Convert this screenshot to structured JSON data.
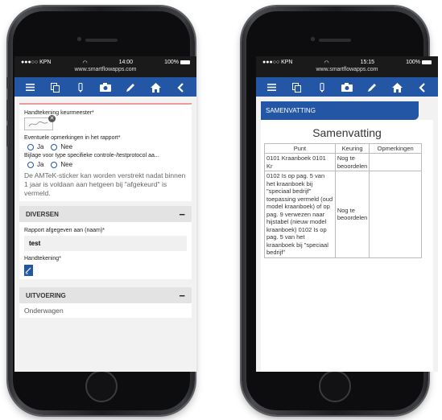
{
  "left": {
    "status": {
      "carrier": "●●●○○ KPN",
      "time": "14:00",
      "battery": "100%",
      "url": "www.smartflowapps.com"
    },
    "signature_label": "Handtekening keurmeester*",
    "remarks_label": "Eventuele opmerkingen in het rapport*",
    "radio_yes": "Ja",
    "radio_no": "Nee",
    "attachment_label": "Bijlage voor type specifieke controle-/testprotocol aa...",
    "notice": "De AMTeK-sticker kan worden verstrekt nadat binnen 1 jaar is voldaan aan hetgeen bij \"afgekeurd\" is vermeld.",
    "section_diversen": "DIVERSEN",
    "report_label": "Rapport afgegeven aan (naam)*",
    "report_value": "test",
    "signature2_label": "Handtekening*",
    "section_uitvoering": "UITVOERING",
    "onderwagen": "Onderwagen"
  },
  "right": {
    "status": {
      "carrier": "●●●○○ KPN",
      "time": "15:15",
      "battery": "100%",
      "url": "www.smartflowapps.com"
    },
    "tab_label": "SAMENVATTING",
    "title": "Samenvatting",
    "columns": [
      "Punt",
      "Keuring",
      "Opmerkingen"
    ],
    "rows": [
      {
        "punt": "0101 Kraanboek 0101 Kr",
        "keuring": "Nog te beoordelen",
        "opmerkingen": ""
      },
      {
        "punt": "0102 Is op pag. 5 van het kraanboek bij \"speciaal bedrijf\" toepassing vermeld (oud model kraanboek) of op pag. 9 verwezen naar hijstabel (nieuw model kraanboek) 0102 Is op pag. 5 van het kraanboek bij \"speciaal bedrijf\"",
        "keuring": "Nog te beoordelen",
        "opmerkingen": ""
      }
    ]
  },
  "icons": [
    "menu-icon",
    "copy-icon",
    "pen-tool-icon",
    "camera-icon",
    "pencil-icon",
    "home-icon",
    "back-icon"
  ]
}
